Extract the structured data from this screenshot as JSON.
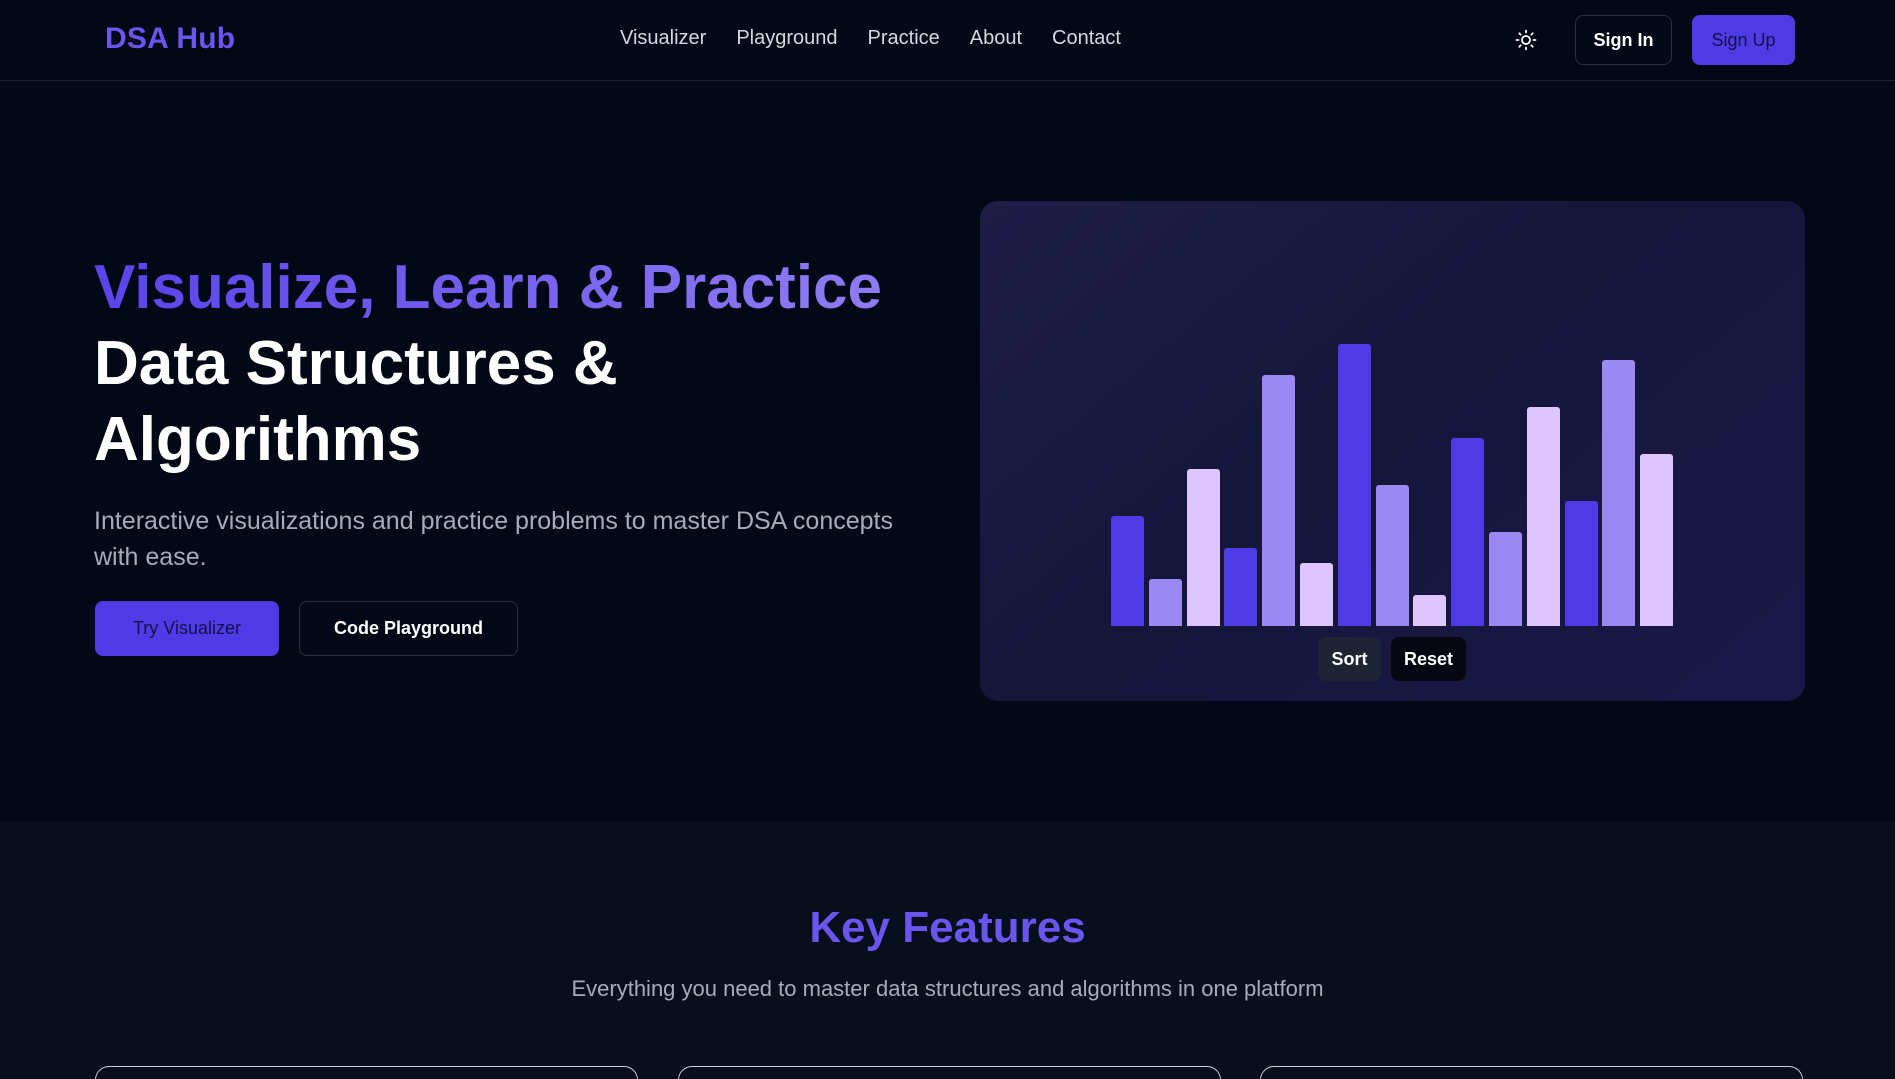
{
  "brand": {
    "name": "DSA Hub",
    "accent": "#6a55ef"
  },
  "nav": {
    "links": [
      "Visualizer",
      "Playground",
      "Practice",
      "About",
      "Contact"
    ],
    "theme_icon": "sun-icon",
    "sign_in": "Sign In",
    "sign_up": "Sign Up"
  },
  "hero": {
    "title_line1": "Visualize, Learn & Practice",
    "title_line2": "Data Structures &",
    "title_line3": "Algorithms",
    "subtitle": "Interactive visualizations and practice problems to master DSA concepts with ease.",
    "cta_primary": "Try Visualizer",
    "cta_secondary": "Code Playground"
  },
  "visualizer": {
    "values": [
      35,
      15,
      50,
      25,
      80,
      20,
      90,
      45,
      10,
      60,
      30,
      70,
      40,
      85,
      55
    ],
    "palette": [
      "#4f3be6",
      "#9a89f3",
      "#dcc6fb"
    ],
    "sort_label": "Sort",
    "reset_label": "Reset"
  },
  "features": {
    "title": "Key Features",
    "subtitle": "Everything you need to master data structures and algorithms in one platform"
  }
}
